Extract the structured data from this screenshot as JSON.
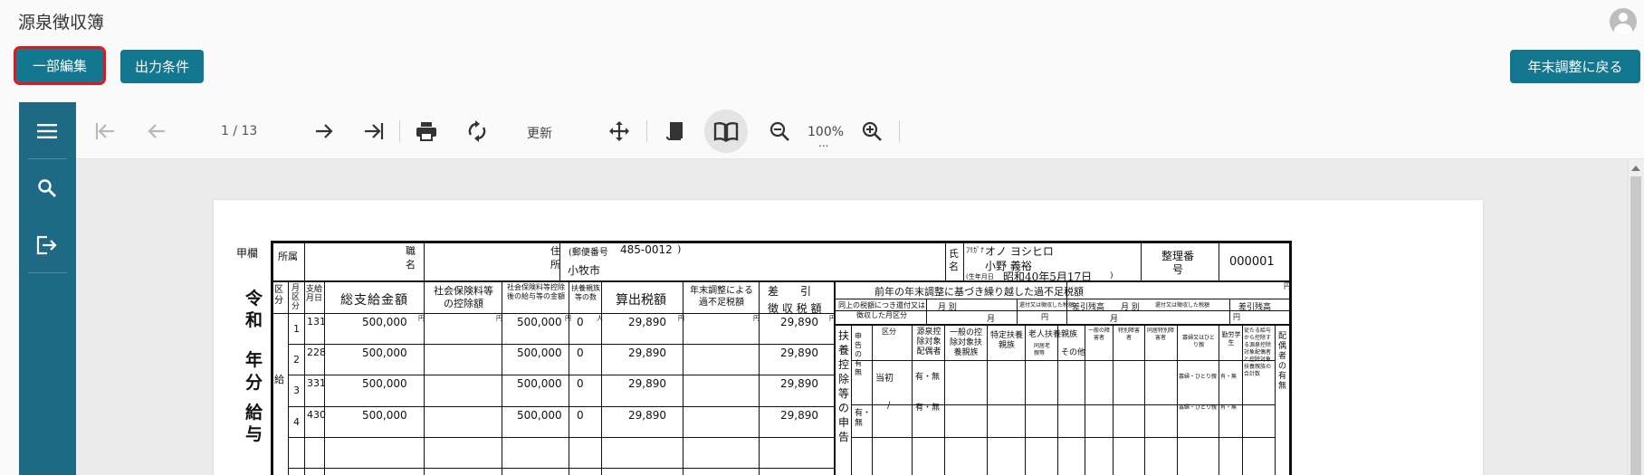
{
  "app": {
    "title": "源泉徴収簿",
    "edit_button": "一部編集",
    "conditions_button": "出力条件",
    "back_button": "年末調整に戻る"
  },
  "toolbar": {
    "page_info": "1 / 13",
    "refresh_label": "更新",
    "zoom_label": "100%",
    "zoom_more": "..."
  },
  "document": {
    "kou_label": "甲欄",
    "shozoku": "所属",
    "shokumei": "職名",
    "jusho": "住所",
    "yubin_label": "(郵便番号",
    "postal_code": "485-0012",
    "postal_close": ")",
    "address": "小牧市",
    "shimei": "氏名",
    "furigana_label": "ﾌﾘｶﾞﾅ",
    "furigana": "オノ ヨシヒロ",
    "name": "小野 義裕",
    "birth_label": "(生年月日",
    "birth": "昭和40年5月17日",
    "birth_close": ")",
    "seiri_label": "整理番号",
    "seiri_number": "000001",
    "reiwa_label": "令和",
    "nen_label": "年",
    "bun_label": "分",
    "kyuyo_label": "給与",
    "kyu_side": "給",
    "headers": {
      "kubun": "区分",
      "tsuki_kubun": "月区分",
      "shikyubi": "支給月日",
      "sou_shikyu": "総支給金額",
      "shakai_hoken": "社会保険料等の控除額",
      "shakai_ato": "社会保険料等控除後の給与等の金額",
      "fuyo_su": "扶養親族等の数",
      "sanshutsu": "算出税額",
      "nenmatsu_fusoku": "年末調整による過不足税額",
      "sashihiki_1": "差　　引",
      "sashihiki_2": "徴 収 税 額",
      "zennen_title": "前年の年末調整に基づき繰り越した過不足税額",
      "sub_row": "同上の税額につき還付又は徴収した月区分",
      "tsuki_betsu": "月 別",
      "kanpu_label": "還付又は徴収した税額",
      "sashihiki_zandaka": "差引残高",
      "fuyo_koujo": "扶養控除等の申告",
      "umu": "申告の有無",
      "kubun2": "区分",
      "gensen_haigusha": "源泉控除対象配偶者",
      "ippan_fuyo": "一般の控除対象扶養親族",
      "tokutei_fuyo": "特定扶養親族",
      "rojin_fuyo": "老人扶養親族",
      "doukyo": "同居老親等",
      "sonota": "その他",
      "ippan_shogai": "一般の障害者",
      "tokubetsu_shogai": "特別障害者",
      "doukyo_tokubetsu": "同居特別障害者",
      "kafu": "寡婦又はひとり親",
      "kinro": "勤労学生",
      "jyuutou": "従たる給与から控除する源泉控除対象配偶者と控除対象扶養親族の合計数",
      "haigusha_umu": "配偶者の有無",
      "toushou": "当初",
      "umu_choice": "有・無",
      "slash": "/",
      "kafu_choice": "寡婦・ひとり親",
      "kinro_choice": "有・無",
      "nin": "人",
      "en": "円",
      "tsuki": "月",
      "yu_mu": "有・無"
    },
    "rows": [
      {
        "no": "1",
        "month": "1",
        "day": "31",
        "gross": "500,000",
        "after_ins": "500,000",
        "dependents": "0",
        "tax": "29,890",
        "net_tax": "29,890"
      },
      {
        "no": "2",
        "month": "2",
        "day": "28",
        "gross": "500,000",
        "after_ins": "500,000",
        "dependents": "0",
        "tax": "29,890",
        "net_tax": "29,890"
      },
      {
        "no": "3",
        "month": "3",
        "day": "31",
        "gross": "500,000",
        "after_ins": "500,000",
        "dependents": "0",
        "tax": "29,890",
        "net_tax": "29,890"
      },
      {
        "no": "4",
        "month": "4",
        "day": "30",
        "gross": "500,000",
        "after_ins": "500,000",
        "dependents": "0",
        "tax": "29,890",
        "net_tax": "29,890"
      }
    ]
  }
}
